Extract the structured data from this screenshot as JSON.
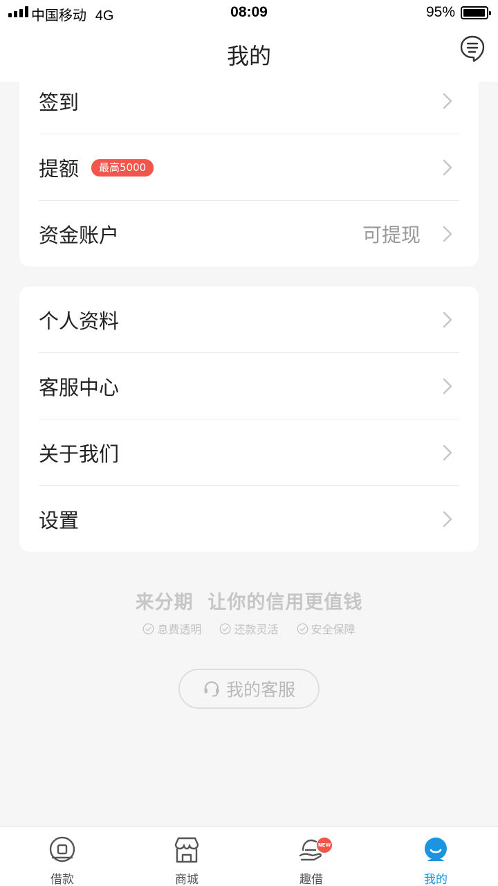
{
  "status_bar": {
    "carrier": "中国移动",
    "network": "4G",
    "time": "08:09",
    "battery": "95%",
    "battery_level": 0.95
  },
  "header": {
    "title": "我的",
    "chat_icon": "chat-bubble-icon"
  },
  "card_account": {
    "items": [
      {
        "label": "签到"
      },
      {
        "label": "提额",
        "badge": "最高5000"
      },
      {
        "label": "资金账户",
        "value": "可提现"
      }
    ]
  },
  "card_settings": {
    "items": [
      {
        "label": "个人资料"
      },
      {
        "label": "客服中心"
      },
      {
        "label": "关于我们"
      },
      {
        "label": "设置"
      }
    ]
  },
  "slogan": {
    "text": "来分期  让你的信用更值钱",
    "features": [
      "息费透明",
      "还款灵活",
      "安全保障"
    ]
  },
  "service_button": {
    "label": "我的客服",
    "icon": "headset-icon"
  },
  "tab_bar": {
    "tabs": [
      {
        "label": "借款",
        "icon": "loan-icon"
      },
      {
        "label": "商城",
        "icon": "store-icon"
      },
      {
        "label": "趣借",
        "icon": "fun-borrow-icon",
        "badge": "NEW"
      },
      {
        "label": "我的",
        "icon": "profile-icon",
        "active": true
      }
    ],
    "active_color": "#1b95e0"
  },
  "colors": {
    "badge": "#f2554a",
    "accent": "#1b95e0",
    "background": "#f6f6f6"
  }
}
